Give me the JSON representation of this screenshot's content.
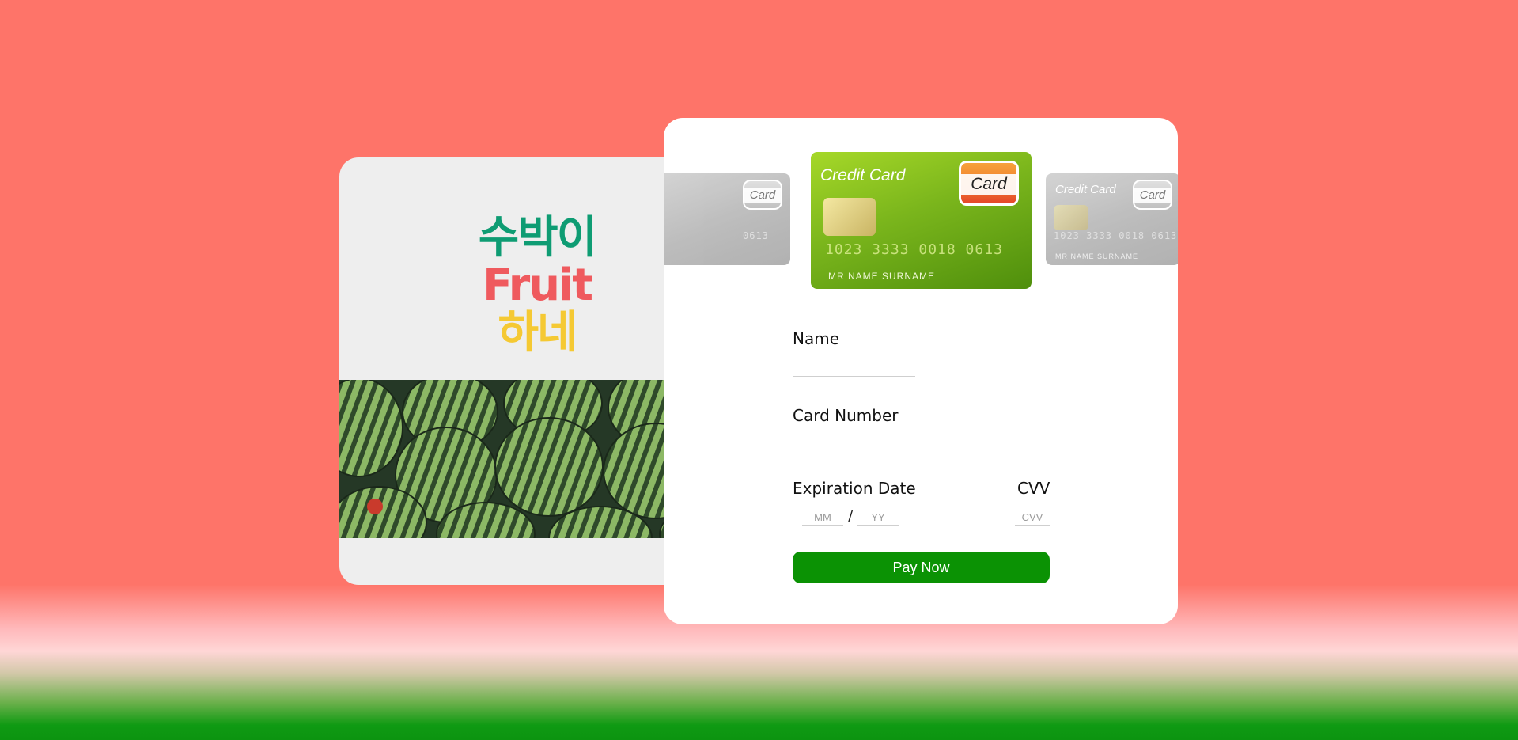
{
  "brand": {
    "line1": "수박이",
    "line2": "Fruit",
    "line3": "하네",
    "colors": {
      "line1": "#0e9c73",
      "line2": "#ef5a5e",
      "line3": "#f5c933"
    }
  },
  "cards": {
    "main": {
      "title": "Credit Card",
      "logo": "Card",
      "number": "1023 3333 0018 0613",
      "holder": "MR NAME SURNAME"
    },
    "left": {
      "logo": "Card",
      "number": "0613"
    },
    "right": {
      "title": "Credit Card",
      "logo": "Card",
      "number": "1023 3333 0018 0613",
      "holder": "MR NAME SURNAME"
    }
  },
  "form": {
    "name_label": "Name",
    "card_number_label": "Card Number",
    "expiration_label": "Expiration Date",
    "cvv_label": "CVV",
    "mm_placeholder": "MM",
    "yy_placeholder": "YY",
    "separator": "/",
    "cvv_placeholder": "CVV",
    "pay_label": "Pay Now"
  },
  "colors": {
    "background": "#fe7469",
    "pay_button": "#0b9204",
    "ground": "#0c9410"
  }
}
